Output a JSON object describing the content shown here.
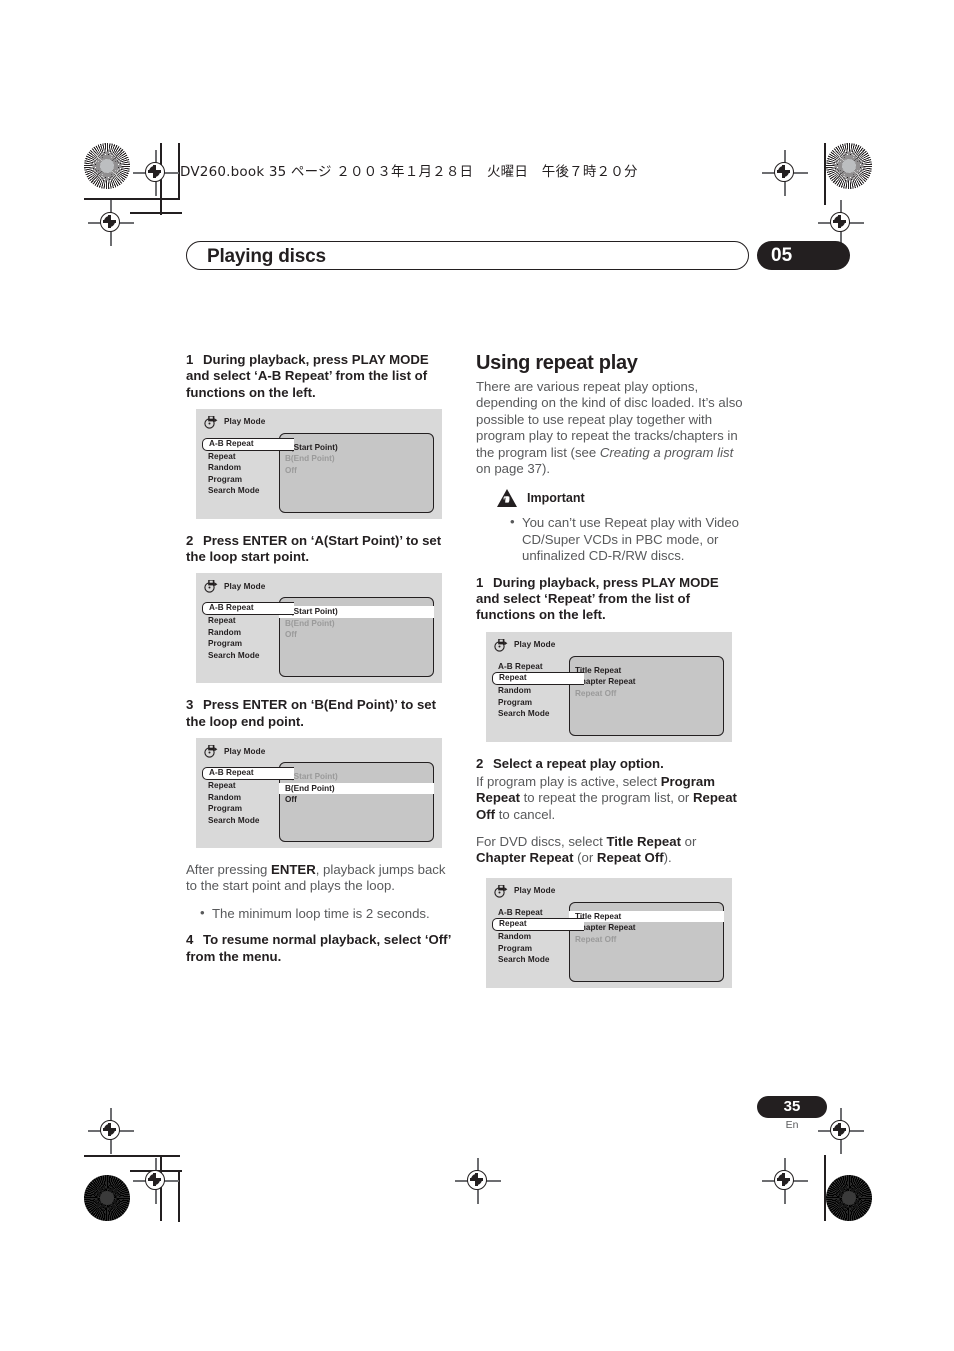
{
  "print_header": {
    "text": "DV260.book  35 ページ  ２００３年１月２８日　火曜日　午後７時２０分"
  },
  "chapter": {
    "title": "Playing discs",
    "number": "05"
  },
  "footer": {
    "page_number": "35",
    "language": "En"
  },
  "left_column": {
    "step1": {
      "num": "1",
      "text": "During playback, press PLAY MODE and select ‘A-B Repeat’ from the list of functions on the left."
    },
    "figure1": {
      "title": "Play Mode",
      "icon": "play-mode-icon",
      "menu": [
        {
          "label": "A-B Repeat",
          "selected": true
        },
        {
          "label": "Repeat",
          "selected": false
        },
        {
          "label": "Random",
          "selected": false
        },
        {
          "label": "Program",
          "selected": false
        },
        {
          "label": "Search Mode",
          "selected": false
        }
      ],
      "options": [
        {
          "label": "A(Start Point)",
          "state": "active"
        },
        {
          "label": "B(End Point)",
          "state": "dim"
        },
        {
          "label": "Off",
          "state": "dim"
        }
      ]
    },
    "step2": {
      "num": "2",
      "text": "Press ENTER on ‘A(Start Point)’ to set the loop start point."
    },
    "figure2": {
      "title": "Play Mode",
      "icon": "play-mode-icon",
      "menu": [
        {
          "label": "A-B Repeat",
          "selected": true
        },
        {
          "label": "Repeat",
          "selected": false
        },
        {
          "label": "Random",
          "selected": false
        },
        {
          "label": "Program",
          "selected": false
        },
        {
          "label": "Search Mode",
          "selected": false
        }
      ],
      "options": [
        {
          "label": "A(Start Point)",
          "state": "highlighted"
        },
        {
          "label": "B(End Point)",
          "state": "dim"
        },
        {
          "label": "Off",
          "state": "dim"
        }
      ]
    },
    "step3": {
      "num": "3",
      "text": "Press ENTER on ‘B(End Point)’ to set the loop end point."
    },
    "figure3": {
      "title": "Play Mode",
      "icon": "play-mode-icon",
      "menu": [
        {
          "label": "A-B Repeat",
          "selected": true
        },
        {
          "label": "Repeat",
          "selected": false
        },
        {
          "label": "Random",
          "selected": false
        },
        {
          "label": "Program",
          "selected": false
        },
        {
          "label": "Search Mode",
          "selected": false
        }
      ],
      "options": [
        {
          "label": "A(Start Point)",
          "state": "dim"
        },
        {
          "label": "B(End Point)",
          "state": "highlighted"
        },
        {
          "label": "Off",
          "state": "active"
        }
      ]
    },
    "after_enter": {
      "lead": "After pressing ",
      "bold": "ENTER",
      "rest": ", playback jumps back to the start point and plays the loop."
    },
    "bullet": "The minimum loop time is 2 seconds.",
    "step4": {
      "num": "4",
      "text": "To resume normal playback, select ‘Off’ from the menu."
    }
  },
  "right_column": {
    "heading": "Using repeat play",
    "intro_part1": "There are various repeat play options, depending on the kind of disc loaded. It’s also possible to use repeat play together with program play to repeat the tracks/chapters in the program list (see ",
    "intro_italic": "Creating a program list",
    "intro_part2": " on page 37).",
    "important": {
      "icon": "important-warning-icon",
      "title": "Important",
      "bullet": "You can’t use Repeat play with Video CD/Super VCDs in PBC mode, or unfinalized CD-R/RW discs."
    },
    "step1": {
      "num": "1",
      "text": "During playback, press PLAY MODE and select ‘Repeat’ from the list of functions on the left."
    },
    "figure1": {
      "title": "Play Mode",
      "icon": "play-mode-icon",
      "menu": [
        {
          "label": "A-B Repeat",
          "selected": false
        },
        {
          "label": "Repeat",
          "selected": true
        },
        {
          "label": "Random",
          "selected": false
        },
        {
          "label": "Program",
          "selected": false
        },
        {
          "label": "Search Mode",
          "selected": false
        }
      ],
      "options": [
        {
          "label": "Title Repeat",
          "state": "active"
        },
        {
          "label": "Chapter Repeat",
          "state": "active"
        },
        {
          "label": "Repeat Off",
          "state": "dim"
        }
      ]
    },
    "step2": {
      "num": "2",
      "text": "Select a repeat play option."
    },
    "para_program": {
      "t1": "If program play is active, select ",
      "b1": "Program Repeat",
      "t2": " to repeat the program list, or ",
      "b2": "Repeat Off",
      "t3": " to cancel."
    },
    "para_dvd": {
      "t1": "For DVD discs, select ",
      "b1": "Title Repeat",
      "t2": " or ",
      "b2": "Chapter Repeat",
      "t3": " (or ",
      "b3": "Repeat Off",
      "t4": ")."
    },
    "figure2": {
      "title": "Play Mode",
      "icon": "play-mode-icon",
      "menu": [
        {
          "label": "A-B Repeat",
          "selected": false
        },
        {
          "label": "Repeat",
          "selected": true
        },
        {
          "label": "Random",
          "selected": false
        },
        {
          "label": "Program",
          "selected": false
        },
        {
          "label": "Search Mode",
          "selected": false
        }
      ],
      "options": [
        {
          "label": "Title Repeat",
          "state": "highlighted"
        },
        {
          "label": "Chapter Repeat",
          "state": "active"
        },
        {
          "label": "Repeat Off",
          "state": "dim"
        }
      ]
    }
  }
}
